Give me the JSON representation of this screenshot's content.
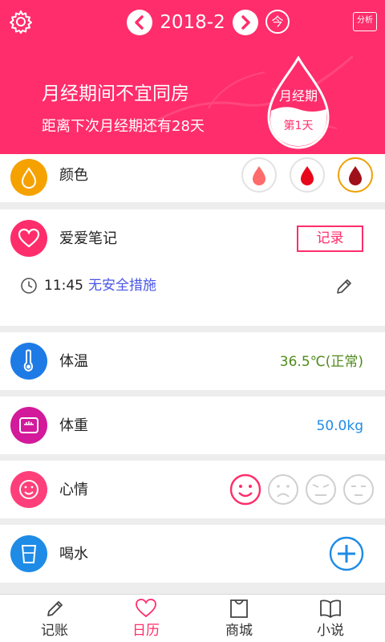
{
  "header": {
    "month": "2018-2",
    "today_label": "今",
    "analysis_label": "分析",
    "headline": "月经期间不宜同房",
    "subline": "距离下次月经期还有28天",
    "drop_title": "月经期",
    "drop_day": "第1天",
    "background_color": "#ff2d6b"
  },
  "color_section": {
    "label": "颜色",
    "icon": "droplet-icon",
    "icon_color": "#f5a200",
    "options": [
      {
        "name": "light-red",
        "color": "#ff6b6b"
      },
      {
        "name": "red",
        "color": "#e8081c"
      },
      {
        "name": "dark-red",
        "color": "#a0101a",
        "selected": true
      }
    ]
  },
  "love_section": {
    "label": "爱爱笔记",
    "record_label": "记录",
    "icon": "heart-icon",
    "icon_color": "#ff2d6b",
    "entry": {
      "time": "11:45",
      "method": "无安全措施"
    }
  },
  "temperature_section": {
    "label": "体温",
    "value": "36.5℃(正常)",
    "icon": "thermometer-icon",
    "icon_color": "#1e7be6",
    "value_color": "#4f8a1c"
  },
  "weight_section": {
    "label": "体重",
    "value": "50.0kg",
    "icon": "scale-icon",
    "icon_color": "#d21a9a",
    "value_color": "#1e8be6"
  },
  "mood_section": {
    "label": "心情",
    "icon": "smile-icon",
    "icon_color": "#ff3f7a",
    "moods": [
      "happy",
      "sad",
      "angry",
      "neutral"
    ],
    "selected": "happy"
  },
  "water_section": {
    "label": "喝水",
    "icon": "cup-icon",
    "icon_color": "#1e8be6"
  },
  "tabs": [
    {
      "label": "记账",
      "icon": "pencil-icon",
      "active": false
    },
    {
      "label": "日历",
      "icon": "heart-outline-icon",
      "active": true
    },
    {
      "label": "商城",
      "icon": "shopping-bag-icon",
      "active": false
    },
    {
      "label": "小说",
      "icon": "book-icon",
      "active": false
    }
  ]
}
